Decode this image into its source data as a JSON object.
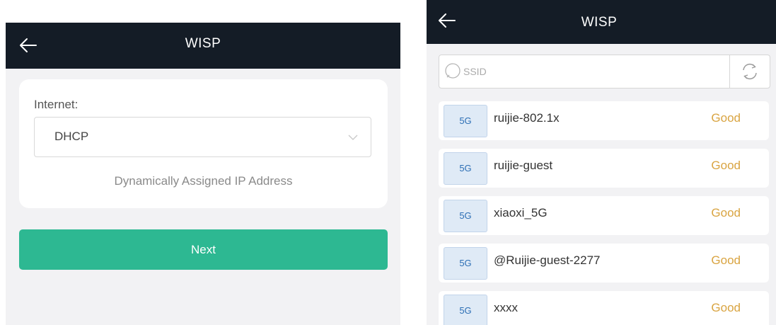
{
  "left": {
    "header": {
      "title": "WISP"
    },
    "internet_label": "Internet:",
    "internet_select": {
      "value": "DHCP"
    },
    "hint": "Dynamically Assigned IP Address",
    "next_label": "Next"
  },
  "right": {
    "header": {
      "title": "WISP"
    },
    "search": {
      "placeholder": "SSID"
    },
    "networks": [
      {
        "band": "5G",
        "ssid": "ruijie-802.1x",
        "signal": "Good"
      },
      {
        "band": "5G",
        "ssid": "ruijie-guest",
        "signal": "Good"
      },
      {
        "band": "5G",
        "ssid": "xiaoxi_5G",
        "signal": "Good"
      },
      {
        "band": "5G",
        "ssid": "@Ruijie-guest-2277",
        "signal": "Good"
      },
      {
        "band": "5G",
        "ssid": "xxxx",
        "signal": "Good"
      }
    ]
  },
  "colors": {
    "header_bg": "#141c26",
    "accent": "#2db892",
    "signal_good": "#d9a441",
    "band_text": "#2d6fb5"
  },
  "icons": [
    "back-arrow-icon",
    "chevron-down-icon",
    "search-icon",
    "refresh-icon"
  ]
}
